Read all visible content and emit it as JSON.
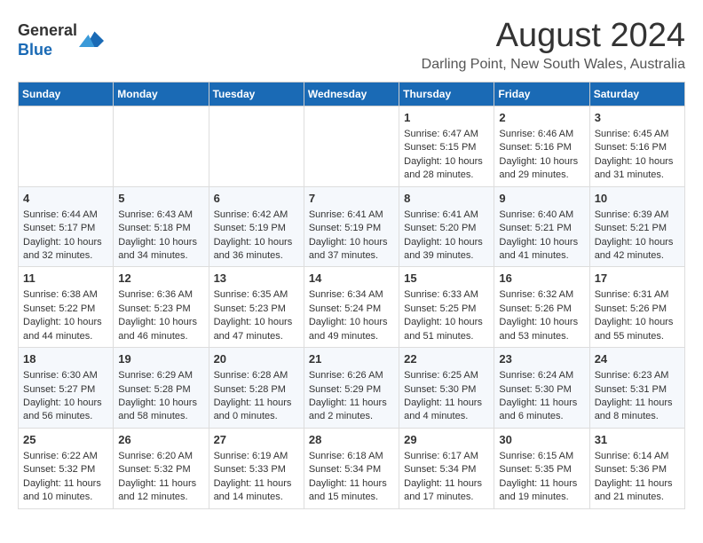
{
  "header": {
    "logo_line1": "General",
    "logo_line2": "Blue",
    "month_year": "August 2024",
    "location": "Darling Point, New South Wales, Australia"
  },
  "days_of_week": [
    "Sunday",
    "Monday",
    "Tuesday",
    "Wednesday",
    "Thursday",
    "Friday",
    "Saturday"
  ],
  "weeks": [
    [
      {
        "day": "",
        "content": ""
      },
      {
        "day": "",
        "content": ""
      },
      {
        "day": "",
        "content": ""
      },
      {
        "day": "",
        "content": ""
      },
      {
        "day": "1",
        "content": "Sunrise: 6:47 AM\nSunset: 5:15 PM\nDaylight: 10 hours and 28 minutes."
      },
      {
        "day": "2",
        "content": "Sunrise: 6:46 AM\nSunset: 5:16 PM\nDaylight: 10 hours and 29 minutes."
      },
      {
        "day": "3",
        "content": "Sunrise: 6:45 AM\nSunset: 5:16 PM\nDaylight: 10 hours and 31 minutes."
      }
    ],
    [
      {
        "day": "4",
        "content": "Sunrise: 6:44 AM\nSunset: 5:17 PM\nDaylight: 10 hours and 32 minutes."
      },
      {
        "day": "5",
        "content": "Sunrise: 6:43 AM\nSunset: 5:18 PM\nDaylight: 10 hours and 34 minutes."
      },
      {
        "day": "6",
        "content": "Sunrise: 6:42 AM\nSunset: 5:19 PM\nDaylight: 10 hours and 36 minutes."
      },
      {
        "day": "7",
        "content": "Sunrise: 6:41 AM\nSunset: 5:19 PM\nDaylight: 10 hours and 37 minutes."
      },
      {
        "day": "8",
        "content": "Sunrise: 6:41 AM\nSunset: 5:20 PM\nDaylight: 10 hours and 39 minutes."
      },
      {
        "day": "9",
        "content": "Sunrise: 6:40 AM\nSunset: 5:21 PM\nDaylight: 10 hours and 41 minutes."
      },
      {
        "day": "10",
        "content": "Sunrise: 6:39 AM\nSunset: 5:21 PM\nDaylight: 10 hours and 42 minutes."
      }
    ],
    [
      {
        "day": "11",
        "content": "Sunrise: 6:38 AM\nSunset: 5:22 PM\nDaylight: 10 hours and 44 minutes."
      },
      {
        "day": "12",
        "content": "Sunrise: 6:36 AM\nSunset: 5:23 PM\nDaylight: 10 hours and 46 minutes."
      },
      {
        "day": "13",
        "content": "Sunrise: 6:35 AM\nSunset: 5:23 PM\nDaylight: 10 hours and 47 minutes."
      },
      {
        "day": "14",
        "content": "Sunrise: 6:34 AM\nSunset: 5:24 PM\nDaylight: 10 hours and 49 minutes."
      },
      {
        "day": "15",
        "content": "Sunrise: 6:33 AM\nSunset: 5:25 PM\nDaylight: 10 hours and 51 minutes."
      },
      {
        "day": "16",
        "content": "Sunrise: 6:32 AM\nSunset: 5:26 PM\nDaylight: 10 hours and 53 minutes."
      },
      {
        "day": "17",
        "content": "Sunrise: 6:31 AM\nSunset: 5:26 PM\nDaylight: 10 hours and 55 minutes."
      }
    ],
    [
      {
        "day": "18",
        "content": "Sunrise: 6:30 AM\nSunset: 5:27 PM\nDaylight: 10 hours and 56 minutes."
      },
      {
        "day": "19",
        "content": "Sunrise: 6:29 AM\nSunset: 5:28 PM\nDaylight: 10 hours and 58 minutes."
      },
      {
        "day": "20",
        "content": "Sunrise: 6:28 AM\nSunset: 5:28 PM\nDaylight: 11 hours and 0 minutes."
      },
      {
        "day": "21",
        "content": "Sunrise: 6:26 AM\nSunset: 5:29 PM\nDaylight: 11 hours and 2 minutes."
      },
      {
        "day": "22",
        "content": "Sunrise: 6:25 AM\nSunset: 5:30 PM\nDaylight: 11 hours and 4 minutes."
      },
      {
        "day": "23",
        "content": "Sunrise: 6:24 AM\nSunset: 5:30 PM\nDaylight: 11 hours and 6 minutes."
      },
      {
        "day": "24",
        "content": "Sunrise: 6:23 AM\nSunset: 5:31 PM\nDaylight: 11 hours and 8 minutes."
      }
    ],
    [
      {
        "day": "25",
        "content": "Sunrise: 6:22 AM\nSunset: 5:32 PM\nDaylight: 11 hours and 10 minutes."
      },
      {
        "day": "26",
        "content": "Sunrise: 6:20 AM\nSunset: 5:32 PM\nDaylight: 11 hours and 12 minutes."
      },
      {
        "day": "27",
        "content": "Sunrise: 6:19 AM\nSunset: 5:33 PM\nDaylight: 11 hours and 14 minutes."
      },
      {
        "day": "28",
        "content": "Sunrise: 6:18 AM\nSunset: 5:34 PM\nDaylight: 11 hours and 15 minutes."
      },
      {
        "day": "29",
        "content": "Sunrise: 6:17 AM\nSunset: 5:34 PM\nDaylight: 11 hours and 17 minutes."
      },
      {
        "day": "30",
        "content": "Sunrise: 6:15 AM\nSunset: 5:35 PM\nDaylight: 11 hours and 19 minutes."
      },
      {
        "day": "31",
        "content": "Sunrise: 6:14 AM\nSunset: 5:36 PM\nDaylight: 11 hours and 21 minutes."
      }
    ]
  ]
}
